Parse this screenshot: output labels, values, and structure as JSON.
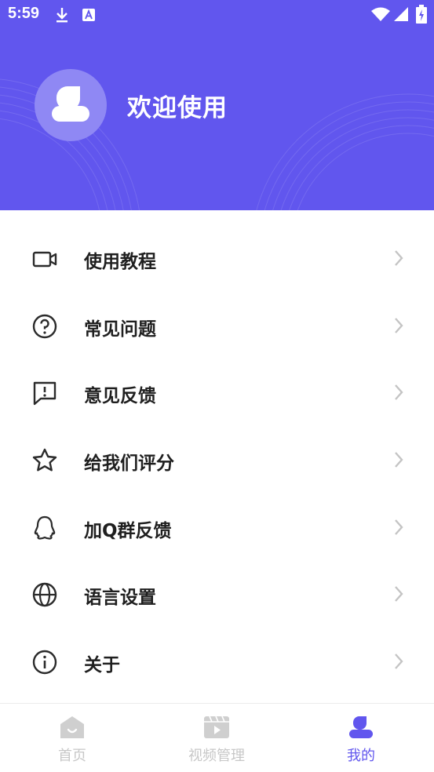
{
  "status_bar": {
    "time": "5:59"
  },
  "header": {
    "welcome_text": "欢迎使用"
  },
  "menu": {
    "items": [
      {
        "label": "使用教程",
        "icon": "video-camera-icon"
      },
      {
        "label": "常见问题",
        "icon": "question-circle-icon"
      },
      {
        "label": "意见反馈",
        "icon": "feedback-message-icon"
      },
      {
        "label": "给我们评分",
        "icon": "star-icon"
      },
      {
        "label": "加Q群反馈",
        "icon": "qq-icon"
      },
      {
        "label": "语言设置",
        "icon": "globe-icon"
      },
      {
        "label": "关于",
        "icon": "info-circle-icon"
      }
    ]
  },
  "bottom_nav": {
    "items": [
      {
        "label": "首页",
        "icon": "home-icon",
        "active": false
      },
      {
        "label": "视频管理",
        "icon": "video-manage-icon",
        "active": false
      },
      {
        "label": "我的",
        "icon": "profile-icon",
        "active": true
      }
    ]
  },
  "colors": {
    "accent": "#6156ee",
    "inactive": "#c7c7c7",
    "text": "#1f1f1f"
  }
}
